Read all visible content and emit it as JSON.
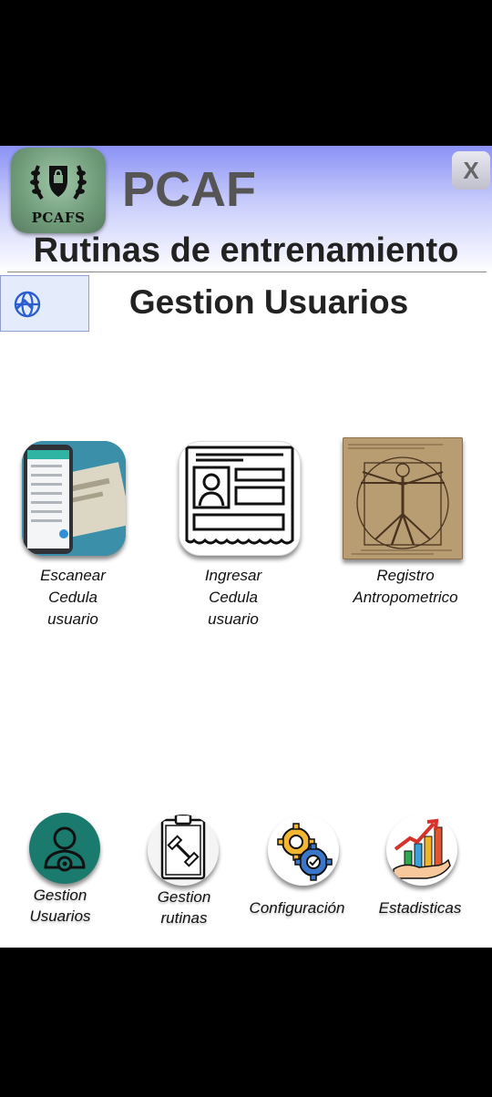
{
  "header": {
    "logo_text": "PCAFS",
    "app_title": "PCAF",
    "close_label": "X",
    "subtitle": "Rutinas de entrenamiento",
    "section_title": "Gestion Usuarios"
  },
  "language": {
    "icon": "globe-icon",
    "toggle_icon": "chevron-up-icon"
  },
  "tiles": [
    {
      "label": "Escanear\nCedula\nusuario",
      "icon": "phone-scan-image"
    },
    {
      "label": "Ingresar\nCedula\nusuario",
      "icon": "id-card-icon"
    },
    {
      "label": "Registro\nAntropometrico",
      "icon": "vitruvian-man-image"
    }
  ],
  "nav": [
    {
      "label": "Gestion\nUsuarios",
      "icon": "user-gear-icon"
    },
    {
      "label": "Gestion\nrutinas",
      "icon": "clipboard-dumbbell-icon"
    },
    {
      "label": "Configuración",
      "icon": "gears-icon"
    },
    {
      "label": "Estadisticas",
      "icon": "growth-chart-icon"
    }
  ],
  "colors": {
    "header_top": "#8a92f5",
    "nav_active": "#1b7a6e"
  }
}
